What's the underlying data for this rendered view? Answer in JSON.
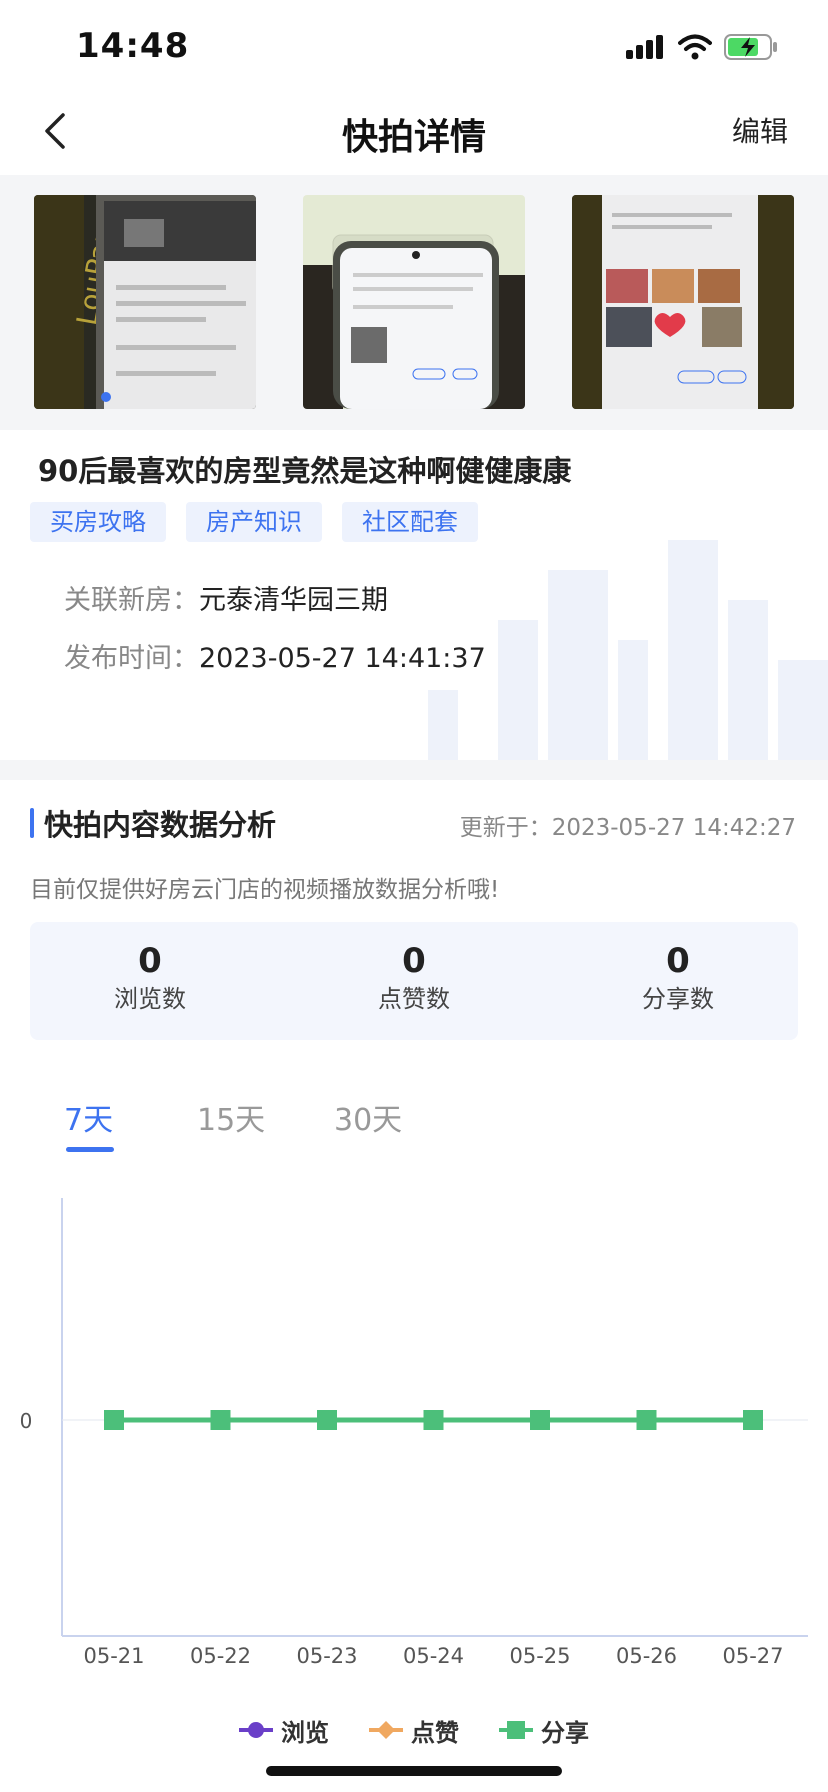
{
  "status_bar": {
    "time": "14:48"
  },
  "nav": {
    "title": "快拍详情",
    "edit_label": "编辑"
  },
  "post": {
    "title": "90后最喜欢的房型竟然是这种啊健健康康",
    "tags": [
      "买房攻略",
      "房产知识",
      "社区配套"
    ],
    "related_label": "关联新房：",
    "related_value": "元泰清华园三期",
    "publish_label": "发布时间：",
    "publish_value": "2023-05-27 14:41:37"
  },
  "analysis": {
    "title": "快拍内容数据分析",
    "updated": "更新于：2023-05-27 14:42:27",
    "note": "目前仅提供好房云门店的视频播放数据分析哦!",
    "stats": [
      {
        "value": "0",
        "label": "浏览数"
      },
      {
        "value": "0",
        "label": "点赞数"
      },
      {
        "value": "0",
        "label": "分享数"
      }
    ],
    "ranges": [
      "7天",
      "15天",
      "30天"
    ]
  },
  "colors": {
    "accent": "#3d73f0",
    "browse": "#6a3fc8",
    "like": "#f0a860",
    "share": "#4cbf7a"
  },
  "chart_data": {
    "type": "line",
    "categories": [
      "05-21",
      "05-22",
      "05-23",
      "05-24",
      "05-25",
      "05-26",
      "05-27"
    ],
    "y_tick": "0",
    "series": [
      {
        "name": "浏览",
        "values": [
          0,
          0,
          0,
          0,
          0,
          0,
          0
        ]
      },
      {
        "name": "点赞",
        "values": [
          0,
          0,
          0,
          0,
          0,
          0,
          0
        ]
      },
      {
        "name": "分享",
        "values": [
          0,
          0,
          0,
          0,
          0,
          0,
          0
        ]
      }
    ],
    "legend": "bottom-center"
  }
}
